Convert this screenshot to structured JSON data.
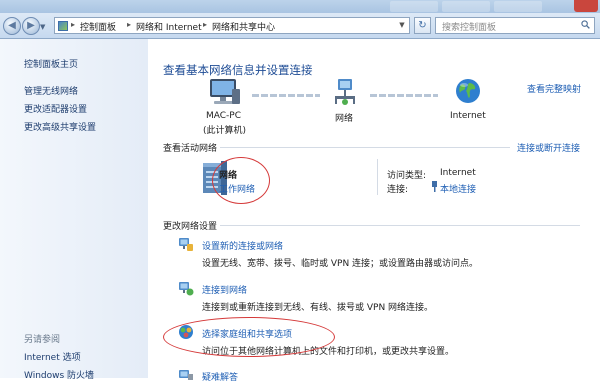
{
  "window": {
    "breadcrumb": [
      "控制面板",
      "网络和 Internet",
      "网络和共享中心"
    ],
    "search_placeholder": "搜索控制面板"
  },
  "sidebar": {
    "home": "控制面板主页",
    "links": [
      "管理无线网络",
      "更改适配器设置",
      "更改高级共享设置"
    ],
    "see_also_title": "另请参阅",
    "see_also": [
      "Internet 选项",
      "Windows 防火墙"
    ]
  },
  "main": {
    "title": "查看基本网络信息并设置连接",
    "view_full_map": "查看完整映射",
    "map": {
      "computer_name": "MAC-PC",
      "computer_sub": "(此计算机)",
      "network": "网络",
      "internet": "Internet"
    },
    "active_section": "查看活动网络",
    "connect_disconnect": "连接或断开连接",
    "active_network": {
      "name": "网络",
      "type": "工作网络",
      "access_label": "访问类型:",
      "access_value": "Internet",
      "connection_label": "连接:",
      "connection_value": "本地连接"
    },
    "change_section": "更改网络设置",
    "tasks": [
      {
        "title": "设置新的连接或网络",
        "desc": "设置无线、宽带、拨号、临时或 VPN 连接；或设置路由器或访问点。"
      },
      {
        "title": "连接到网络",
        "desc": "连接到或重新连接到无线、有线、拨号或 VPN 网络连接。"
      },
      {
        "title": "选择家庭组和共享选项",
        "desc": "访问位于其他网络计算机上的文件和打印机，或更改共享设置。"
      },
      {
        "title": "疑难解答",
        "desc": ""
      }
    ]
  },
  "colors": {
    "link": "#1f5fb4",
    "title": "#1e4c95",
    "annotation": "#d53a3a",
    "sidebar_bg": "#e4ecf7"
  }
}
